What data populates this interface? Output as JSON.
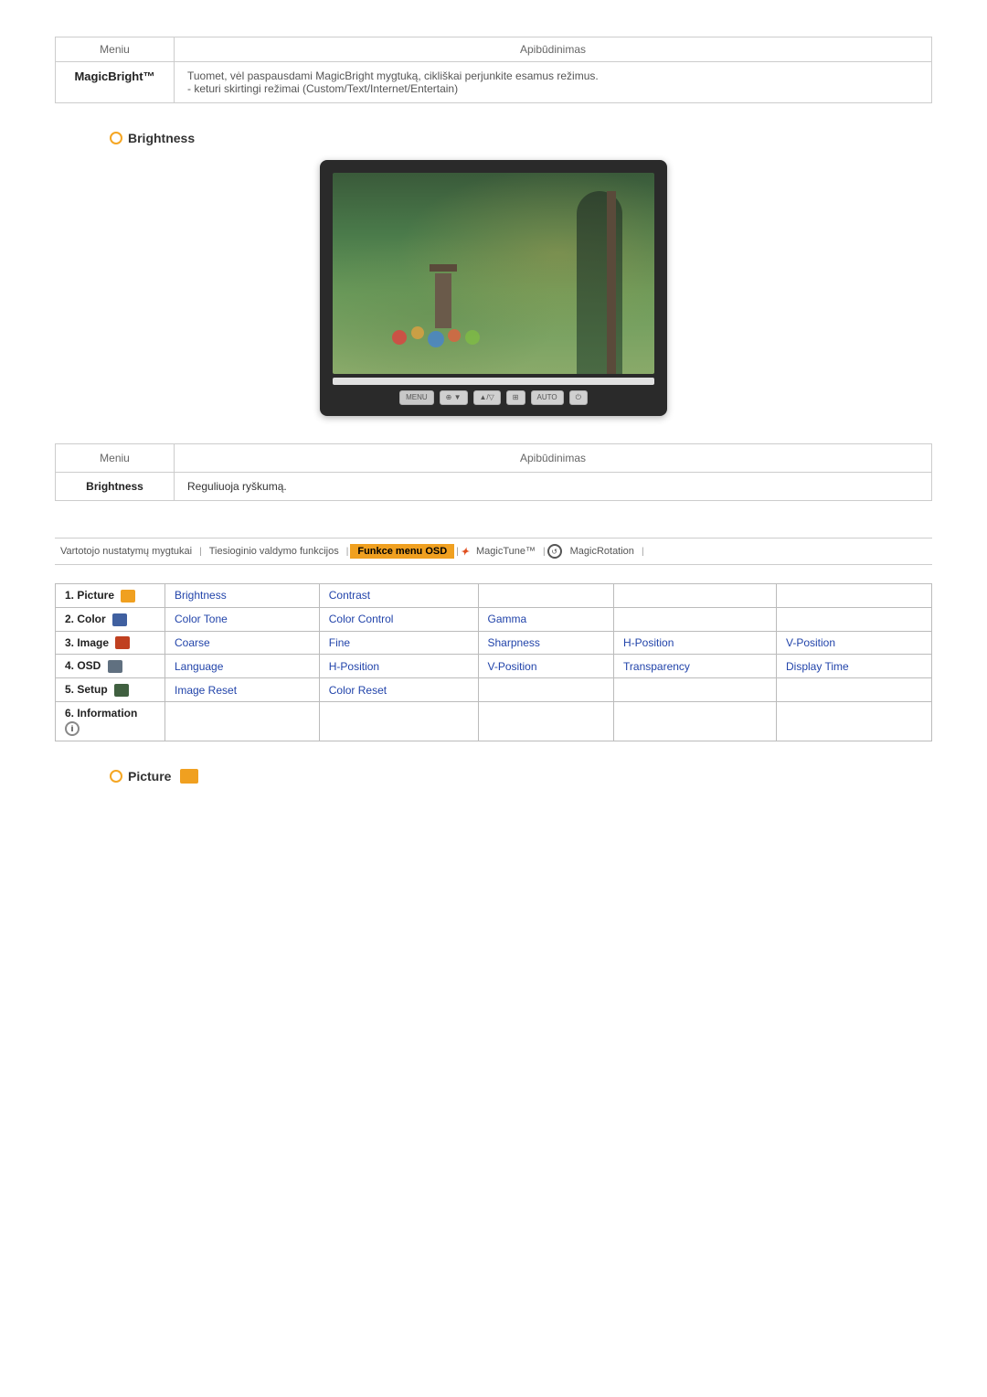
{
  "top_table": {
    "header": {
      "col_menu": "Meniu",
      "col_desc": "Apibūdinimas"
    },
    "rows": [
      {
        "menu": "MagicBright™",
        "description": "Tuomet, vėl paspausdami MagicBright mygtuką, cikliškai perjunkite esamus režimus.\n- keturi skirtingi režimai (Custom/Text/Internet/Entertain)"
      }
    ]
  },
  "brightness_section": {
    "title": "Brightness",
    "monitor_alt": "Monitor showing garden scene"
  },
  "second_table": {
    "header": {
      "col_menu": "Meniu",
      "col_desc": "Apibūdinimas"
    },
    "rows": [
      {
        "menu": "Brightness",
        "description": "Reguliuoja ryškumą."
      }
    ]
  },
  "nav_bar": {
    "items": [
      {
        "label": "Vartotojo nustatymų mygtukai",
        "active": false
      },
      {
        "label": "Tiesioginio valdymo funkcijos",
        "active": false
      },
      {
        "label": "Funkce menu OSD",
        "active": true
      },
      {
        "label": "MagicTune™",
        "active": false
      },
      {
        "label": "MagicRotation",
        "active": false
      }
    ]
  },
  "osd_table": {
    "rows": [
      {
        "label": "1. Picture",
        "icon": "orange",
        "cells": [
          "Brightness",
          "Contrast",
          "",
          "",
          ""
        ]
      },
      {
        "label": "2. Color",
        "icon": "blue",
        "cells": [
          "Color Tone",
          "Color Control",
          "Gamma",
          "",
          ""
        ]
      },
      {
        "label": "3. Image",
        "icon": "red",
        "cells": [
          "Coarse",
          "Fine",
          "Sharpness",
          "H-Position",
          "V-Position"
        ]
      },
      {
        "label": "4. OSD",
        "icon": "gray-dark",
        "cells": [
          "Language",
          "H-Position",
          "V-Position",
          "Transparency",
          "Display Time"
        ]
      },
      {
        "label": "5. Setup",
        "icon": "green-dark",
        "cells": [
          "Image Reset",
          "Color Reset",
          "",
          "",
          ""
        ]
      },
      {
        "label": "6. Information",
        "icon": "red-small",
        "cells": [
          "",
          "",
          "",
          "",
          ""
        ]
      }
    ]
  },
  "picture_section": {
    "title": "Picture",
    "icon_alt": "Picture icon"
  },
  "button_labels": {
    "menu": "MENU",
    "auto": "AUTO"
  }
}
